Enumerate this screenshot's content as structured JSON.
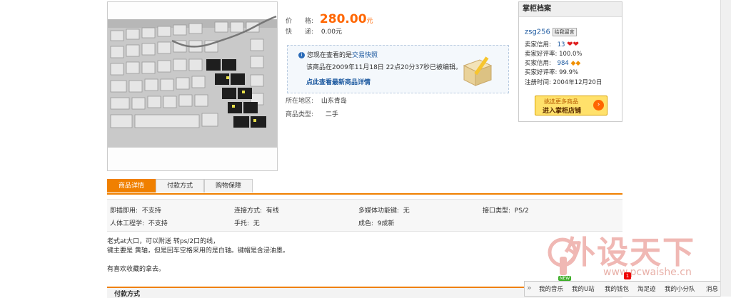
{
  "item": {
    "price_label": "价　　格:",
    "price_value": "280.00",
    "price_unit": "元",
    "shipping_label": "快　　递:",
    "shipping_value": "0.00元",
    "location_label": "所在地区:",
    "location_value": "山东青岛",
    "type_label": "商品类型:",
    "type_value": "二手"
  },
  "snapshot": {
    "prefix": "您现在查看的是",
    "link": "交易快照",
    "edited_text": "该商品在2009年11月18日  22点20分37秒已被编辑。",
    "latest_link": "点此查看最新商品详情"
  },
  "shop": {
    "title": "掌柜档案",
    "seller_name": "zsg256",
    "message_button": "给我留言",
    "seller_credit_label": "卖家信用:",
    "seller_credit_value": "13",
    "seller_rate_label": "卖家好评率:",
    "seller_rate_value": "100.0%",
    "buyer_credit_label": "买家信用:",
    "buyer_credit_value": "984",
    "buyer_rate_label": "买家好评率:",
    "buyer_rate_value": "99.9%",
    "reg_label": "注册时间:",
    "reg_value": "2004年12月20日",
    "btn_line1": "挑选更多商品",
    "btn_line2": "进入掌柜店铺"
  },
  "tabs": [
    "商品详情",
    "付款方式",
    "购物保障"
  ],
  "specs": [
    {
      "label": "即插即用:",
      "value": "不支持"
    },
    {
      "label": "连接方式:",
      "value": "有线"
    },
    {
      "label": "多媒体功能键:",
      "value": "无"
    },
    {
      "label": "接口类型:",
      "value": "PS/2"
    },
    {
      "label": "人体工程学:",
      "value": "不支持"
    },
    {
      "label": "手托:",
      "value": "无"
    },
    {
      "label": "成色:",
      "value": "9成新"
    }
  ],
  "description": {
    "line1": "老式at大口，可以附送  转ps/2口的线，",
    "line2": "键主要是  黄轴，但是回车空格采用的是白轴。键帽是含浸油墨。",
    "line3": "有喜欢收藏的拿去。"
  },
  "bottom_section": {
    "title": "付款方式"
  },
  "watermark": {
    "line1": "外设天下",
    "line2": "www.pcwaishe.cn"
  },
  "dock": {
    "arrow": "»",
    "items": [
      "我的音乐",
      "我的U站",
      "我的钱包",
      "淘足迹",
      "我的小分队",
      "消息"
    ],
    "new_badge": "NEW",
    "count_badge": "1"
  },
  "colors": {
    "accent": "#f08000",
    "price": "#ff6600",
    "link": "#1e5aa0"
  }
}
